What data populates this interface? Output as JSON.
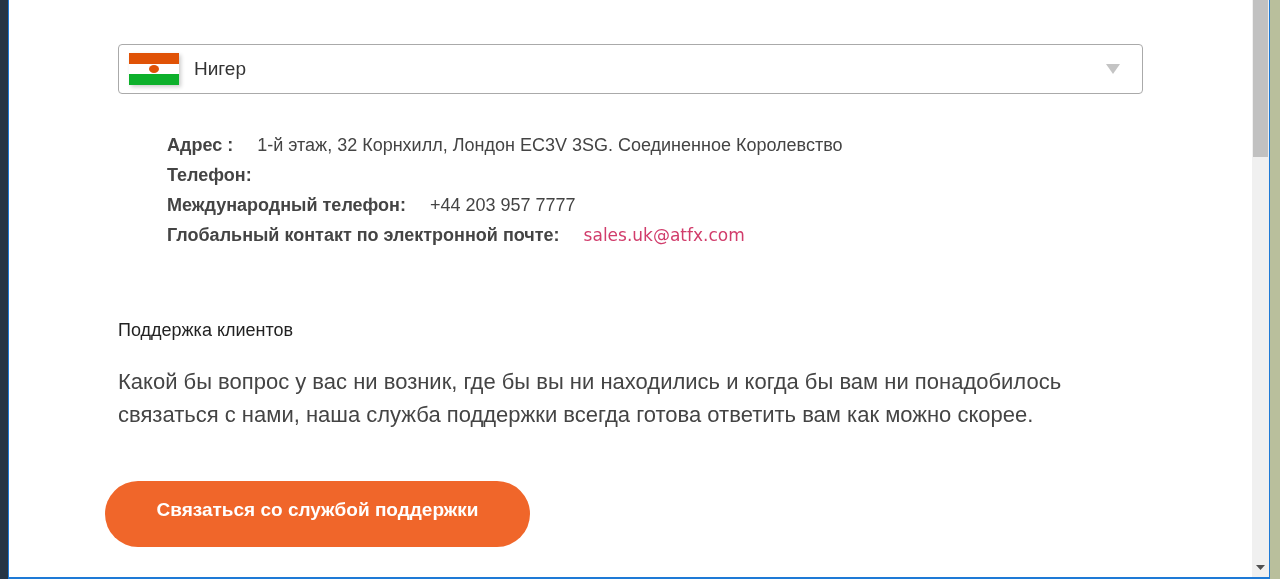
{
  "country_select": {
    "value": "Нигер"
  },
  "contacts": [
    {
      "label": "Адрес :",
      "value": "1-й этаж, 32 Корнхилл, Лондон EC3V 3SG. Соединенное Королевство",
      "kind": "text"
    },
    {
      "label": "Телефон:"
    },
    {
      "label": "Международный телефон:",
      "value": "+44 203 957 7777",
      "kind": "text"
    },
    {
      "label": "Глобальный контакт по электронной почте:",
      "value": "sales.uk@atfx.com",
      "kind": "link"
    }
  ],
  "support": {
    "heading": "Поддержка клиентов",
    "text": "Какой бы вопрос у вас ни возник, где бы вы ни находились и когда бы вам ни понадобилось связаться с нами, наша служба поддержки всегда готова ответить вам как можно скорее.",
    "button": "Связаться со службой поддержки"
  }
}
